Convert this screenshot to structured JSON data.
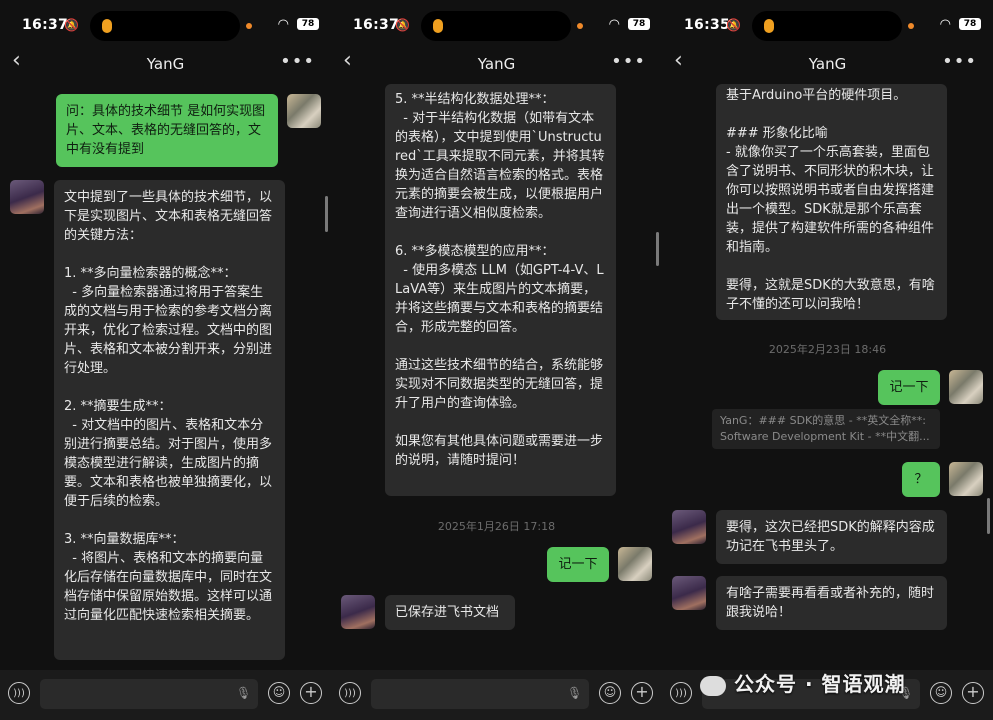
{
  "status": [
    {
      "time": "16:37",
      "battery": "78"
    },
    {
      "time": "16:37",
      "battery": "78"
    },
    {
      "time": "16:35",
      "battery": "78"
    }
  ],
  "chat_title": "YanG",
  "panel1": {
    "user_msg": "问：具体的技术细节 是如何实现图片、文本、表格的无缝回答的，文中有没有提到",
    "bot_msg": "文中提到了一些具体的技术细节，以下是实现图片、文本和表格无缝回答的关键方法：\n\n1. **多向量检索器的概念**：\n  - 多向量检索器通过将用于答案生成的文档与用于检索的参考文档分离开来，优化了检索过程。文档中的图片、表格和文本被分割开来，分别进行处理。\n\n2. **摘要生成**：\n  - 对文档中的图片、表格和文本分别进行摘要总结。对于图片，使用多模态模型进行解读，生成图片的摘要。文本和表格也被单独摘要化，以便于后续的检索。\n\n3. **向量数据库**：\n  - 将图片、表格和文本的摘要向量化后存储在向量数据库中，同时在文档存储中保留原始数据。这样可以通过向量化匹配快速检索相关摘要。"
  },
  "panel2": {
    "bot_msg": "5. **半结构化数据处理**：\n  - 对于半结构化数据（如带有文本的表格），文中提到使用`Unstructured`工具来提取不同元素，并将其转换为适合自然语言检索的格式。表格元素的摘要会被生成，以便根据用户查询进行语义相似度检索。\n\n6. **多模态模型的应用**：\n  - 使用多模态 LLM（如GPT-4-V、LLaVA等）来生成图片的文本摘要，并将这些摘要与文本和表格的摘要结合，形成完整的回答。\n\n通过这些技术细节的结合，系统能够实现对不同数据类型的无缝回答，提升了用户的查询体验。\n\n如果您有其他具体问题或需要进一步的说明，请随时提问！",
    "timestamp": "2025年1月26日 17:18",
    "user_msg": "记一下",
    "bot_reply": "已保存进飞书文档"
  },
  "panel3": {
    "bot_msg": "基于Arduino平台的硬件项目。\n\n### 形象化比喻\n- 就像你买了一个乐高套装，里面包含了说明书、不同形状的积木块，让你可以按照说明书或者自由发挥搭建出一个模型。SDK就是那个乐高套装，提供了构建软件所需的各种组件和指南。\n\n要得，这就是SDK的大致意思，有啥子不懂的还可以问我哈！",
    "timestamp": "2025年2月23日 18:46",
    "user_msg1": "记一下",
    "quote_line1": "YanG：### SDK的意思 - **英文全称**:",
    "quote_line2": "Software Development Kit - **中文翻...",
    "user_msg2": "？",
    "bot_reply1": "要得，这次已经把SDK的解释内容成功记在飞书里头了。",
    "bot_reply2": "有啥子需要再看看或者补充的，随时跟我说哈！"
  },
  "watermark": "公众号 · 智语观潮",
  "icons": [
    "back-icon",
    "more-icon",
    "mic-icon",
    "voice-icon",
    "emoji-icon",
    "plus-icon",
    "wifi-icon",
    "bell-mute-icon"
  ]
}
